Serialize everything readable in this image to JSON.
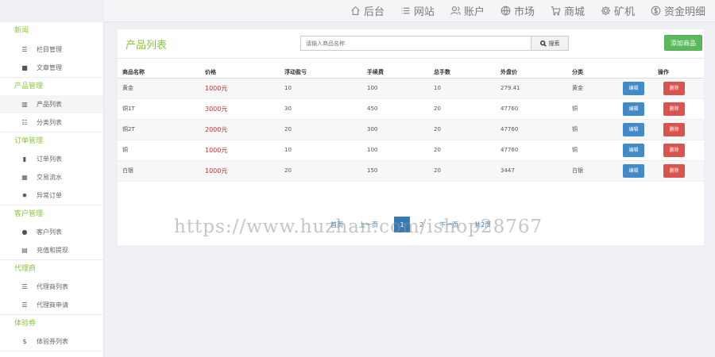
{
  "topnav": [
    {
      "label": "后台",
      "icon": "home-icon"
    },
    {
      "label": "网站",
      "icon": "list-icon"
    },
    {
      "label": "账户",
      "icon": "users-icon"
    },
    {
      "label": "市场",
      "icon": "globe-icon"
    },
    {
      "label": "商城",
      "icon": "cart-icon"
    },
    {
      "label": "矿机",
      "icon": "gear-icon"
    },
    {
      "label": "资金明细",
      "icon": "dollar-circle-icon"
    }
  ],
  "sidebar": {
    "groups": [
      {
        "title": "新闻",
        "items": [
          {
            "label": "栏目管理",
            "icon": "list-icon"
          },
          {
            "label": "文章管理",
            "icon": "book-icon"
          }
        ]
      },
      {
        "title": "产品管理",
        "items": [
          {
            "label": "产品列表",
            "icon": "grid-icon"
          },
          {
            "label": "分类列表",
            "icon": "split-icon"
          }
        ]
      },
      {
        "title": "订单管理",
        "items": [
          {
            "label": "订单列表",
            "icon": "bookmark-icon"
          },
          {
            "label": "交易流水",
            "icon": "calendar-icon"
          },
          {
            "label": "异常订单",
            "icon": "gear-icon"
          }
        ]
      },
      {
        "title": "客户管理",
        "items": [
          {
            "label": "客户列表",
            "icon": "user-icon"
          },
          {
            "label": "充值和提现",
            "icon": "inbox-icon"
          }
        ]
      },
      {
        "title": "代理商",
        "items": [
          {
            "label": "代理商列表",
            "icon": "list-icon"
          },
          {
            "label": "代理商申请",
            "icon": "list-icon"
          }
        ]
      },
      {
        "title": "体验券",
        "items": [
          {
            "label": "体验券列表",
            "icon": "dollar-icon"
          }
        ]
      }
    ]
  },
  "panel": {
    "title": "产品列表",
    "search_placeholder": "请输入商品名称",
    "search_label": "搜索",
    "add_label": "添加商品"
  },
  "table": {
    "headers": [
      "商品名称",
      "价格",
      "浮动盈亏",
      "手续费",
      "总手数",
      "外盘价",
      "分类",
      "操作"
    ],
    "edit_label": "编辑",
    "delete_label": "删除",
    "rows": [
      [
        "黄金",
        "1000元",
        "10",
        "100",
        "10",
        "279.41",
        "黄金"
      ],
      [
        "铜1T",
        "3000元",
        "30",
        "450",
        "20",
        "47760",
        "铜"
      ],
      [
        "铜2T",
        "2000元",
        "20",
        "300",
        "20",
        "47760",
        "铜"
      ],
      [
        "铜",
        "1000元",
        "10",
        "100",
        "20",
        "47760",
        "铜"
      ],
      [
        "白银",
        "1000元",
        "20",
        "150",
        "20",
        "3447",
        "白银"
      ]
    ]
  },
  "pager": {
    "first": "首页",
    "prev": "上一页",
    "current": "1",
    "next_num": "2",
    "next": "下一页",
    "total": "共2页"
  },
  "watermark": "https://www.huzhan.com/ishop28767"
}
